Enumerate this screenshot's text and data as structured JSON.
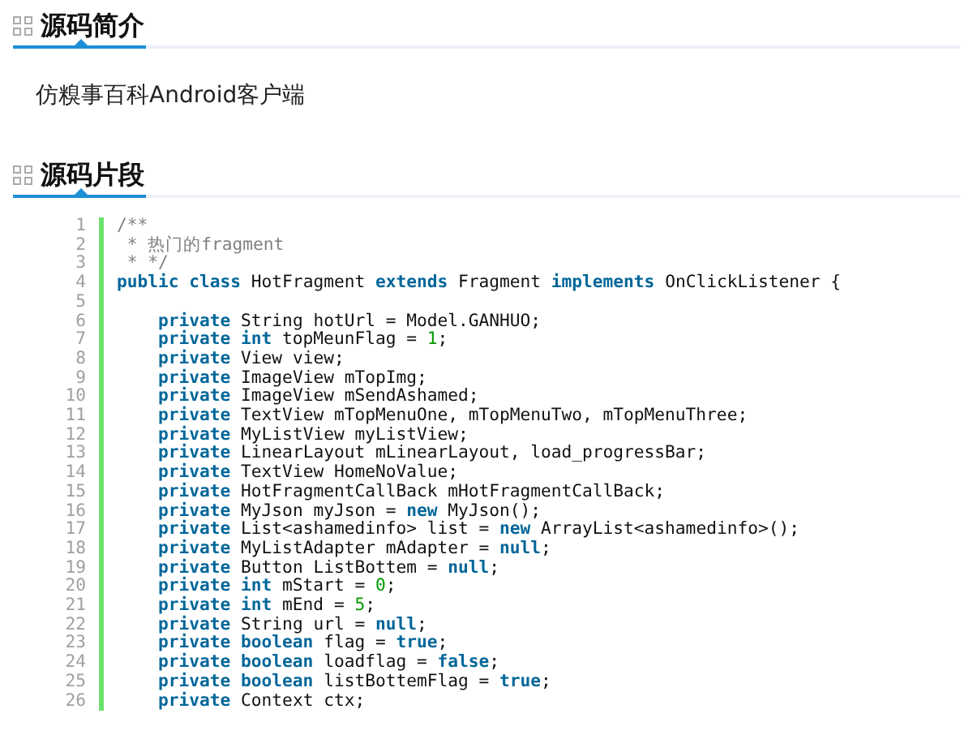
{
  "sections": [
    {
      "title": "源码简介",
      "description": "仿糗事百科Android客户端"
    },
    {
      "title": "源码片段"
    }
  ],
  "code": {
    "lines": [
      {
        "number": "1",
        "tokens": [
          {
            "kind": "comment",
            "text": "/**"
          }
        ]
      },
      {
        "number": "2",
        "tokens": [
          {
            "kind": "comment",
            "text": " * 热门的fragment"
          }
        ]
      },
      {
        "number": "3",
        "tokens": [
          {
            "kind": "comment",
            "text": " * */"
          }
        ]
      },
      {
        "number": "4",
        "tokens": [
          {
            "kind": "keyword",
            "text": "public class"
          },
          {
            "kind": "plain",
            "text": " HotFragment "
          },
          {
            "kind": "keyword",
            "text": "extends"
          },
          {
            "kind": "plain",
            "text": " Fragment "
          },
          {
            "kind": "keyword",
            "text": "implements"
          },
          {
            "kind": "plain",
            "text": " OnClickListener {"
          }
        ]
      },
      {
        "number": "5"
      },
      {
        "number": "6",
        "tokens": [
          {
            "kind": "keyword",
            "text": "    private"
          },
          {
            "kind": "plain",
            "text": " String hotUrl = Model.GANHUO;"
          }
        ]
      },
      {
        "number": "7",
        "tokens": [
          {
            "kind": "keyword",
            "text": "    private int"
          },
          {
            "kind": "plain",
            "text": " topMeunFlag = "
          },
          {
            "kind": "number",
            "text": "1"
          },
          {
            "kind": "plain",
            "text": ";"
          }
        ]
      },
      {
        "number": "8",
        "tokens": [
          {
            "kind": "keyword",
            "text": "    private"
          },
          {
            "kind": "plain",
            "text": " View view;"
          }
        ]
      },
      {
        "number": "9",
        "tokens": [
          {
            "kind": "keyword",
            "text": "    private"
          },
          {
            "kind": "plain",
            "text": " ImageView mTopImg;"
          }
        ]
      },
      {
        "number": "10",
        "tokens": [
          {
            "kind": "keyword",
            "text": "    private"
          },
          {
            "kind": "plain",
            "text": " ImageView mSendAshamed;"
          }
        ]
      },
      {
        "number": "11",
        "tokens": [
          {
            "kind": "keyword",
            "text": "    private"
          },
          {
            "kind": "plain",
            "text": " TextView mTopMenuOne, mTopMenuTwo, mTopMenuThree;"
          }
        ]
      },
      {
        "number": "12",
        "tokens": [
          {
            "kind": "keyword",
            "text": "    private"
          },
          {
            "kind": "plain",
            "text": " MyListView myListView;"
          }
        ]
      },
      {
        "number": "13",
        "tokens": [
          {
            "kind": "keyword",
            "text": "    private"
          },
          {
            "kind": "plain",
            "text": " LinearLayout mLinearLayout, load_progressBar;"
          }
        ]
      },
      {
        "number": "14",
        "tokens": [
          {
            "kind": "keyword",
            "text": "    private"
          },
          {
            "kind": "plain",
            "text": " TextView HomeNoValue;"
          }
        ]
      },
      {
        "number": "15",
        "tokens": [
          {
            "kind": "keyword",
            "text": "    private"
          },
          {
            "kind": "plain",
            "text": " HotFragmentCallBack mHotFragmentCallBack;"
          }
        ]
      },
      {
        "number": "16",
        "tokens": [
          {
            "kind": "keyword",
            "text": "    private"
          },
          {
            "kind": "plain",
            "text": " MyJson myJson = "
          },
          {
            "kind": "keyword",
            "text": "new"
          },
          {
            "kind": "plain",
            "text": " MyJson();"
          }
        ]
      },
      {
        "number": "17",
        "tokens": [
          {
            "kind": "keyword",
            "text": "    private"
          },
          {
            "kind": "plain",
            "text": " List<ashamedinfo> list = "
          },
          {
            "kind": "keyword",
            "text": "new"
          },
          {
            "kind": "plain",
            "text": " ArrayList<ashamedinfo>();"
          }
        ]
      },
      {
        "number": "18",
        "tokens": [
          {
            "kind": "keyword",
            "text": "    private"
          },
          {
            "kind": "plain",
            "text": " MyListAdapter mAdapter = "
          },
          {
            "kind": "keyword",
            "text": "null"
          },
          {
            "kind": "plain",
            "text": ";"
          }
        ]
      },
      {
        "number": "19",
        "tokens": [
          {
            "kind": "keyword",
            "text": "    private"
          },
          {
            "kind": "plain",
            "text": " Button ListBottem = "
          },
          {
            "kind": "keyword",
            "text": "null"
          },
          {
            "kind": "plain",
            "text": ";"
          }
        ]
      },
      {
        "number": "20",
        "tokens": [
          {
            "kind": "keyword",
            "text": "    private int"
          },
          {
            "kind": "plain",
            "text": " mStart = "
          },
          {
            "kind": "number",
            "text": "0"
          },
          {
            "kind": "plain",
            "text": ";"
          }
        ]
      },
      {
        "number": "21",
        "tokens": [
          {
            "kind": "keyword",
            "text": "    private int"
          },
          {
            "kind": "plain",
            "text": " mEnd = "
          },
          {
            "kind": "number",
            "text": "5"
          },
          {
            "kind": "plain",
            "text": ";"
          }
        ]
      },
      {
        "number": "22",
        "tokens": [
          {
            "kind": "keyword",
            "text": "    private"
          },
          {
            "kind": "plain",
            "text": " String url = "
          },
          {
            "kind": "keyword",
            "text": "null"
          },
          {
            "kind": "plain",
            "text": ";"
          }
        ]
      },
      {
        "number": "23",
        "tokens": [
          {
            "kind": "keyword",
            "text": "    private boolean"
          },
          {
            "kind": "plain",
            "text": " flag = "
          },
          {
            "kind": "keyword",
            "text": "true"
          },
          {
            "kind": "plain",
            "text": ";"
          }
        ]
      },
      {
        "number": "24",
        "tokens": [
          {
            "kind": "keyword",
            "text": "    private boolean"
          },
          {
            "kind": "plain",
            "text": " loadflag = "
          },
          {
            "kind": "keyword",
            "text": "false"
          },
          {
            "kind": "plain",
            "text": ";"
          }
        ]
      },
      {
        "number": "25",
        "tokens": [
          {
            "kind": "keyword",
            "text": "    private boolean"
          },
          {
            "kind": "plain",
            "text": " listBottemFlag = "
          },
          {
            "kind": "keyword",
            "text": "true"
          },
          {
            "kind": "plain",
            "text": ";"
          }
        ]
      },
      {
        "number": "26",
        "tokens": [
          {
            "kind": "keyword",
            "text": "    private"
          },
          {
            "kind": "plain",
            "text": " Context ctx;"
          }
        ]
      }
    ]
  }
}
